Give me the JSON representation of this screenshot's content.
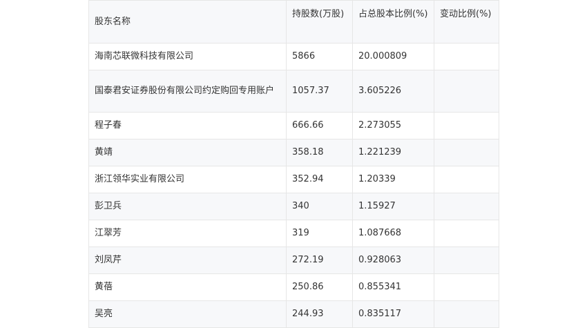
{
  "table": {
    "headers": [
      "股东名称",
      "持股数(万股)",
      "占总股本比例(%)",
      "变动比例(%)"
    ],
    "rows": [
      {
        "name": "海南芯联微科技有限公司",
        "shares": "5866",
        "ratio": "20.000809",
        "change": ""
      },
      {
        "name": "国泰君安证券股份有限公司约定购回专用账户",
        "shares": "1057.37",
        "ratio": "3.605226",
        "change": ""
      },
      {
        "name": "程子春",
        "shares": "666.66",
        "ratio": "2.273055",
        "change": ""
      },
      {
        "name": "黄靖",
        "shares": "358.18",
        "ratio": "1.221239",
        "change": ""
      },
      {
        "name": "浙江领华实业有限公司",
        "shares": "352.94",
        "ratio": "1.20339",
        "change": ""
      },
      {
        "name": "彭卫兵",
        "shares": "340",
        "ratio": "1.15927",
        "change": ""
      },
      {
        "name": "江翠芳",
        "shares": "319",
        "ratio": "1.087668",
        "change": ""
      },
      {
        "name": "刘凤芹",
        "shares": "272.19",
        "ratio": "0.928063",
        "change": ""
      },
      {
        "name": "黄蓓",
        "shares": "250.86",
        "ratio": "0.855341",
        "change": ""
      },
      {
        "name": "吴亮",
        "shares": "244.93",
        "ratio": "0.835117",
        "change": ""
      }
    ]
  }
}
